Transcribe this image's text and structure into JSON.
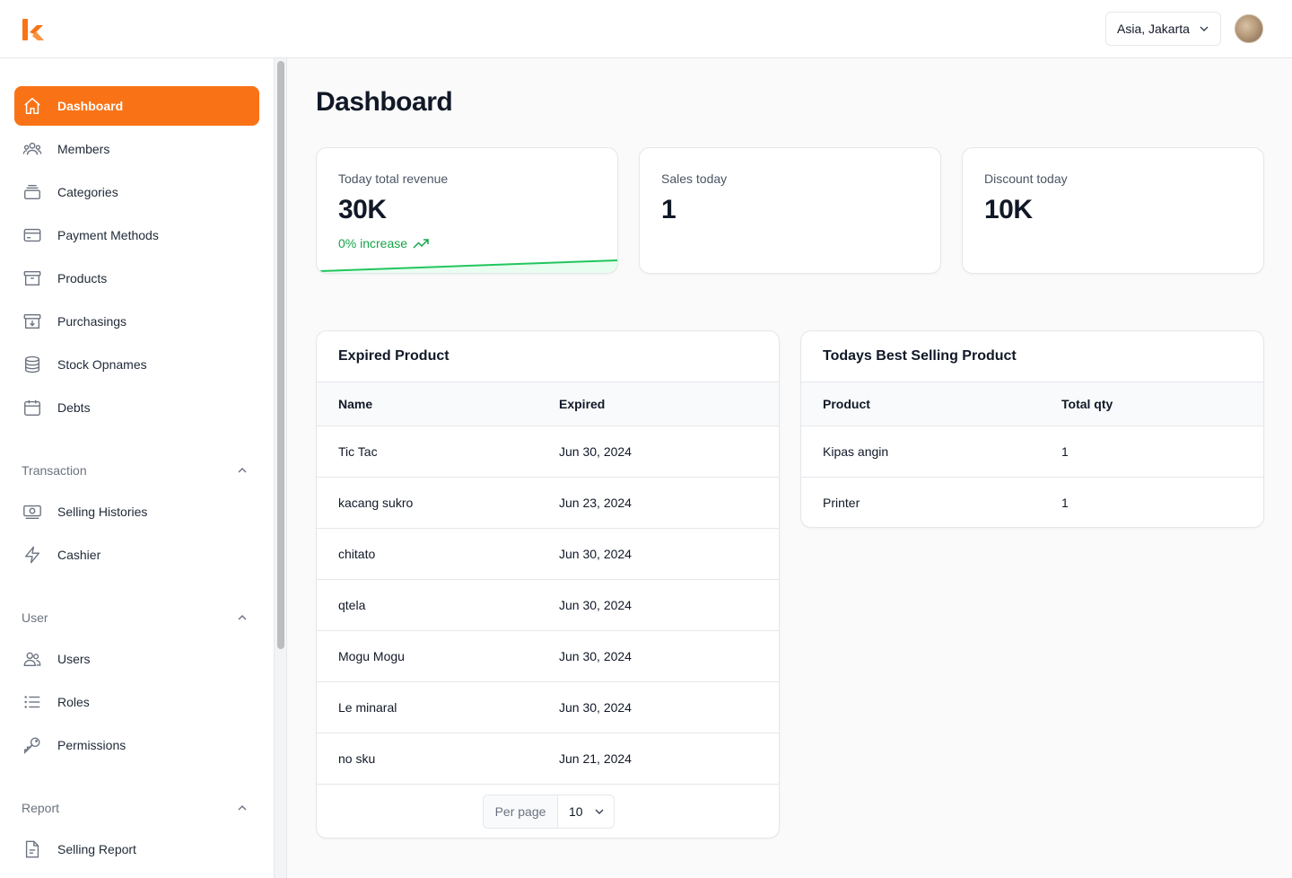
{
  "header": {
    "logo": "k-logo",
    "timezone": "Asia, Jakarta",
    "avatar": "user-avatar"
  },
  "sidebar": {
    "main_items": [
      {
        "label": "Dashboard",
        "icon": "home-icon",
        "active": true
      },
      {
        "label": "Members",
        "icon": "users-group-icon"
      },
      {
        "label": "Categories",
        "icon": "stack-icon"
      },
      {
        "label": "Payment Methods",
        "icon": "credit-card-icon"
      },
      {
        "label": "Products",
        "icon": "archive-box-icon"
      },
      {
        "label": "Purchasings",
        "icon": "archive-down-icon"
      },
      {
        "label": "Stock Opnames",
        "icon": "database-icon"
      },
      {
        "label": "Debts",
        "icon": "calendar-icon"
      }
    ],
    "groups": [
      {
        "label": "Transaction",
        "items": [
          {
            "label": "Selling Histories",
            "icon": "banknotes-icon"
          },
          {
            "label": "Cashier",
            "icon": "bolt-icon"
          }
        ]
      },
      {
        "label": "User",
        "items": [
          {
            "label": "Users",
            "icon": "users-icon"
          },
          {
            "label": "Roles",
            "icon": "list-icon"
          },
          {
            "label": "Permissions",
            "icon": "key-icon"
          }
        ]
      },
      {
        "label": "Report",
        "items": [
          {
            "label": "Selling Report",
            "icon": "document-icon"
          }
        ]
      }
    ]
  },
  "main": {
    "title": "Dashboard",
    "stats": [
      {
        "label": "Today total revenue",
        "value": "30K",
        "trend": "0% increase"
      },
      {
        "label": "Sales today",
        "value": "1"
      },
      {
        "label": "Discount today",
        "value": "10K"
      }
    ],
    "expired": {
      "title": "Expired Product",
      "columns": [
        "Name",
        "Expired"
      ],
      "rows": [
        [
          "Tic Tac",
          "Jun 30, 2024"
        ],
        [
          "kacang sukro",
          "Jun 23, 2024"
        ],
        [
          "chitato",
          "Jun 30, 2024"
        ],
        [
          "qtela",
          "Jun 30, 2024"
        ],
        [
          "Mogu Mogu",
          "Jun 30, 2024"
        ],
        [
          "Le minaral",
          "Jun 30, 2024"
        ],
        [
          "no sku",
          "Jun 21, 2024"
        ]
      ],
      "per_page_label": "Per page",
      "per_page_value": "10"
    },
    "best_selling": {
      "title": "Todays Best Selling Product",
      "columns": [
        "Product",
        "Total qty"
      ],
      "rows": [
        [
          "Kipas angin",
          "1"
        ],
        [
          "Printer",
          "1"
        ]
      ]
    }
  },
  "colors": {
    "accent": "#f97316",
    "success": "#16a34a"
  }
}
